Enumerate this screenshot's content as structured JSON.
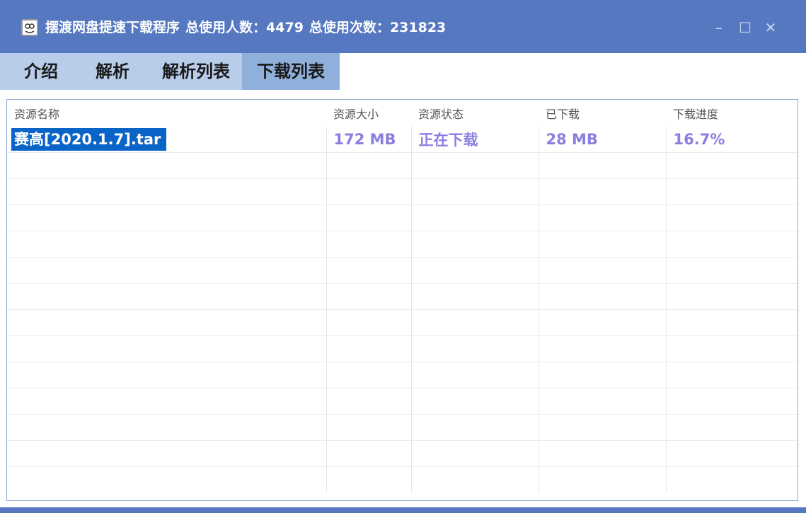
{
  "window": {
    "app_title": "摆渡网盘提速下载程序",
    "users_label": "总使用人数：",
    "users_count": "4479",
    "uses_label": "总使用次数：",
    "uses_count": "231823",
    "minimize": "–",
    "maximize": "☐",
    "close": "✕"
  },
  "tabs": [
    {
      "label": "介绍"
    },
    {
      "label": "解析"
    },
    {
      "label": "解析列表"
    },
    {
      "label": "下载列表"
    }
  ],
  "table": {
    "headers": [
      "资源名称",
      "资源大小",
      "资源状态",
      "已下载",
      "下载进度"
    ],
    "rows": [
      {
        "name": "赛高[2020.1.7].tar",
        "size": "172 MB",
        "status": "正在下载",
        "downloaded": "28 MB",
        "progress": "16.7%"
      }
    ]
  },
  "colors": {
    "titlebar": "#5578c0",
    "tab_strip": "#b8cdea",
    "tab_active": "#8fb0db",
    "row_text": "#8a7fe0",
    "selection": "#0a64c8"
  },
  "icons": {
    "app": "app-icon",
    "minimize": "minimize-icon",
    "maximize": "maximize-icon",
    "close": "close-icon"
  }
}
